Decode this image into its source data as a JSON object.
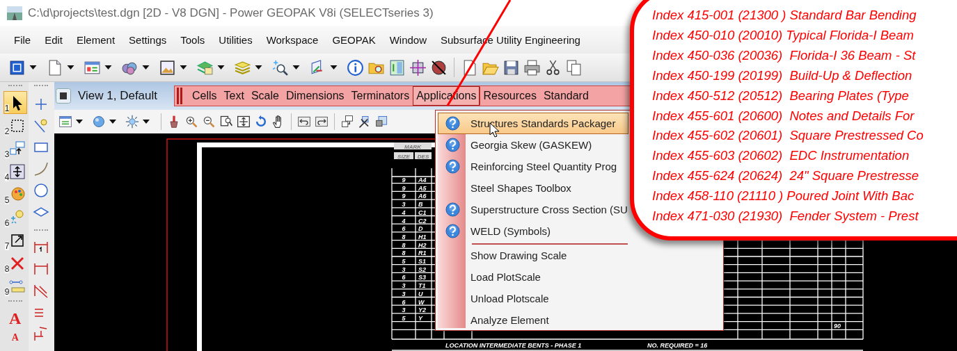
{
  "window": {
    "title": "C:\\d\\projects\\test.dgn [2D - V8 DGN] - Power GEOPAK V8i (SELECTseries 3)"
  },
  "menu_bar": [
    "File",
    "Edit",
    "Element",
    "Settings",
    "Tools",
    "Utilities",
    "Workspace",
    "GEOPAK",
    "Window",
    "Subsurface Utility Engineering"
  ],
  "palette": [
    {
      "key": "1",
      "selected": true
    },
    {
      "key": "2",
      "selected": false
    },
    {
      "key": "3",
      "selected": false
    },
    {
      "key": "4",
      "selected": false
    },
    {
      "key": "5",
      "selected": false
    },
    {
      "key": "6",
      "selected": false
    },
    {
      "key": "7",
      "selected": false
    },
    {
      "key": "8",
      "selected": false
    },
    {
      "key": "9",
      "selected": false
    }
  ],
  "text_tools": [
    "A",
    "A"
  ],
  "view": {
    "title": "View 1, Default"
  },
  "custom_toolbar": [
    {
      "label": "Cells",
      "selected": false
    },
    {
      "label": "Text",
      "selected": false
    },
    {
      "label": "Scale",
      "selected": false
    },
    {
      "label": "Dimensions",
      "selected": false
    },
    {
      "label": "Terminators",
      "selected": false
    },
    {
      "label": "Applications",
      "selected": true
    },
    {
      "label": "Resources",
      "selected": false
    },
    {
      "label": "Standard",
      "selected": false
    }
  ],
  "applications_menu": [
    {
      "label": "Structures Standards Packager",
      "help": true,
      "selected": true,
      "separator_before": false
    },
    {
      "label": "Georgia Skew (GASKEW)",
      "help": true,
      "selected": false,
      "separator_before": false
    },
    {
      "label": "Reinforcing Steel Quantity Prog",
      "help": true,
      "selected": false,
      "separator_before": false
    },
    {
      "label": "Steel Shapes Toolbox",
      "help": false,
      "selected": false,
      "separator_before": false
    },
    {
      "label": "Superstructure Cross Section (SU",
      "help": true,
      "selected": false,
      "separator_before": false
    },
    {
      "label": "WELD (Symbols)",
      "help": true,
      "selected": false,
      "separator_before": false
    },
    {
      "label": "Show Drawing Scale",
      "help": false,
      "selected": false,
      "separator_before": true
    },
    {
      "label": "Load PlotScale",
      "help": false,
      "selected": false,
      "separator_before": false
    },
    {
      "label": "Unload Plotscale",
      "help": false,
      "selected": false,
      "separator_before": false
    },
    {
      "label": "Analyze Element",
      "help": false,
      "selected": false,
      "separator_before": false
    }
  ],
  "drawing": {
    "header_mark": "MARK",
    "header_size": "SIZE",
    "header_des": "DES",
    "rows": [
      {
        "size": "9",
        "mark": "A4"
      },
      {
        "size": "9",
        "mark": "A5"
      },
      {
        "size": "9",
        "mark": "A6"
      },
      {
        "size": "3",
        "mark": "B"
      },
      {
        "size": "4",
        "mark": "C1"
      },
      {
        "size": "4",
        "mark": "C2"
      },
      {
        "size": "6",
        "mark": "D"
      },
      {
        "size": "8",
        "mark": "H1"
      },
      {
        "size": "8",
        "mark": "H2"
      },
      {
        "size": "8",
        "mark": "R1"
      },
      {
        "size": "5",
        "mark": "S1"
      },
      {
        "size": "3",
        "mark": "S2"
      },
      {
        "size": "6",
        "mark": "S3"
      },
      {
        "size": "3",
        "mark": "T1"
      },
      {
        "size": "3",
        "mark": "U"
      },
      {
        "size": "6",
        "mark": "W"
      },
      {
        "size": "3",
        "mark": "Y2"
      },
      {
        "size": "5",
        "mark": "Y"
      }
    ],
    "location": "LOCATION   INTERMEDIATE BENTS - PHASE 1",
    "required": "NO. REQUIRED = 16",
    "value": "90"
  },
  "callout": {
    "lines": [
      "Index 415-001 (21300 ) Standard Bar Bending",
      "Index 450-010 (20010) Typical Florida-I Beam",
      "Index 450-036 (20036)  Florida-I 36 Beam - St",
      "Index 450-199 (20199)  Build-Up & Deflection",
      "Index 450-512 (20512)  Bearing Plates (Type",
      "Index 455-601 (20600)  Notes and Details For",
      "Index 455-602 (20601)  Square Prestressed Co",
      "Index 455-603 (20602)  EDC Instrumentation",
      "Index 455-624 (20624)  24\" Square Prestresse",
      "Index 458-110 (21110 ) Poured Joint With Bac",
      "Index 471-030 (21930)  Fender System - Prest"
    ]
  }
}
